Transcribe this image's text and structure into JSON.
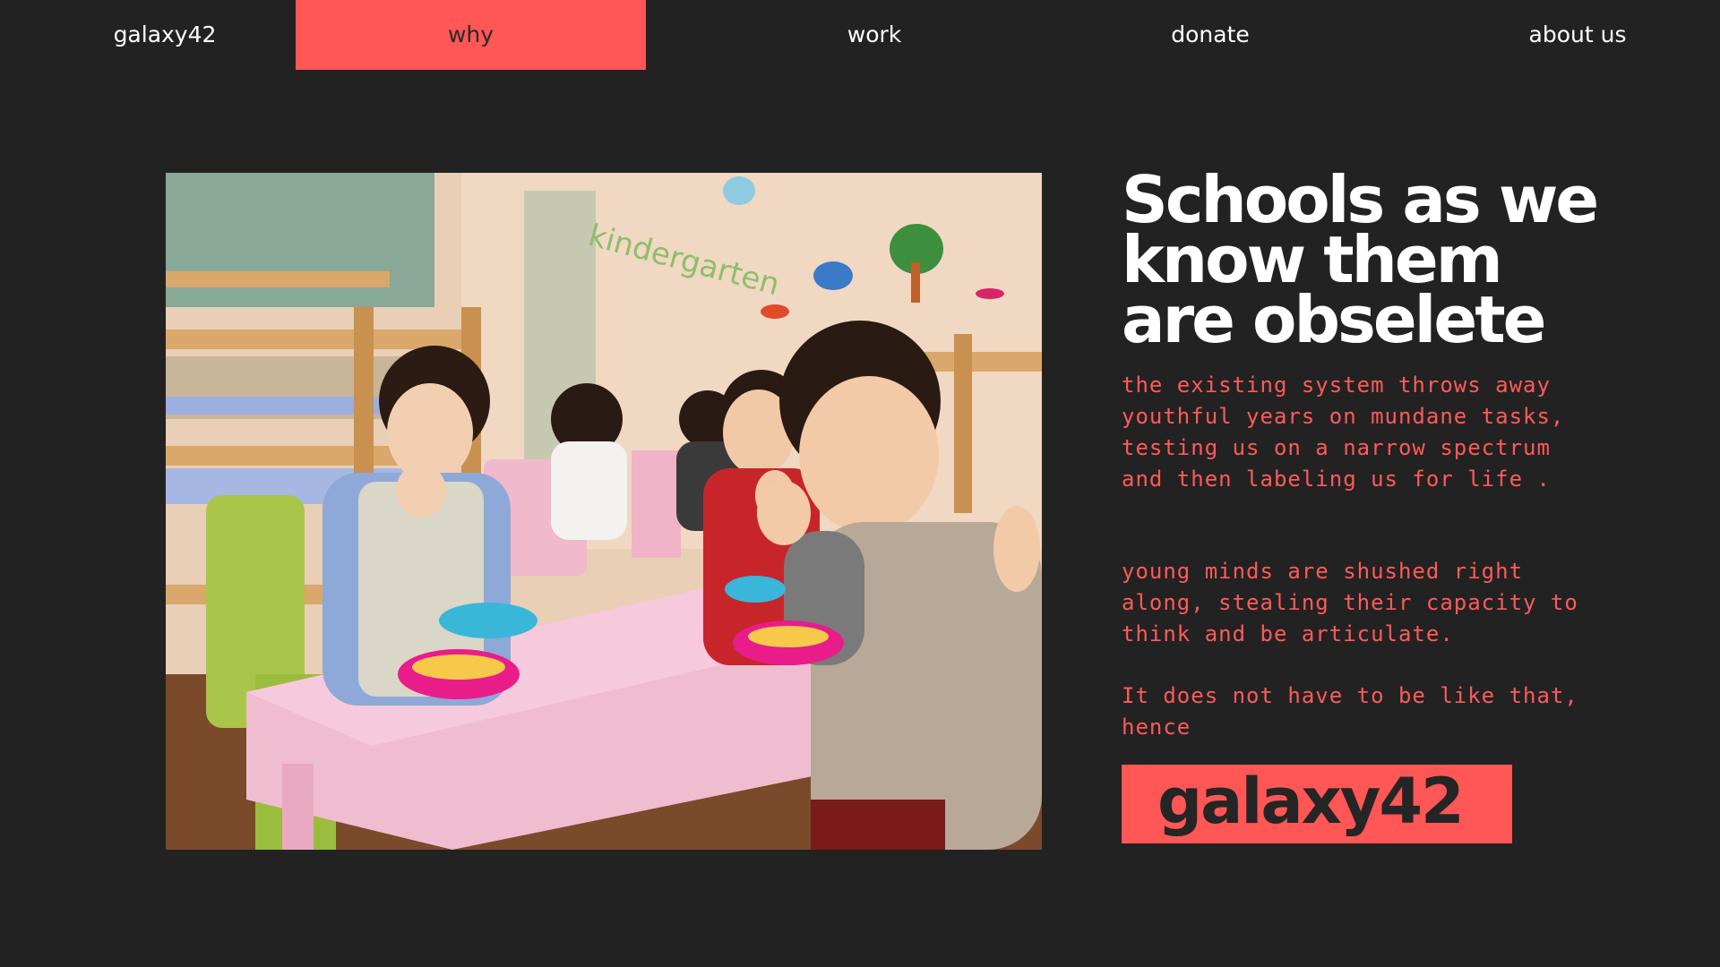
{
  "nav": {
    "home": "galaxy42",
    "why": "why",
    "work": "work",
    "donate": "donate",
    "about": "about us"
  },
  "hero": {
    "headline": "Schools as we know them are obselete",
    "paragraphs": [
      "the existing system throws away youthful years on mundane tasks, testing us on a narrow spectrum and then labeling us for life .",
      "young minds are shushed right along, stealing their capacity to think and be articulate.",
      "It does not have to be like that, hence"
    ],
    "brand": "galaxy42"
  },
  "colors": {
    "background": "#222222",
    "accent": "#ff5656",
    "text_light": "#ffffff",
    "text_accent": "#ff5a5a"
  }
}
